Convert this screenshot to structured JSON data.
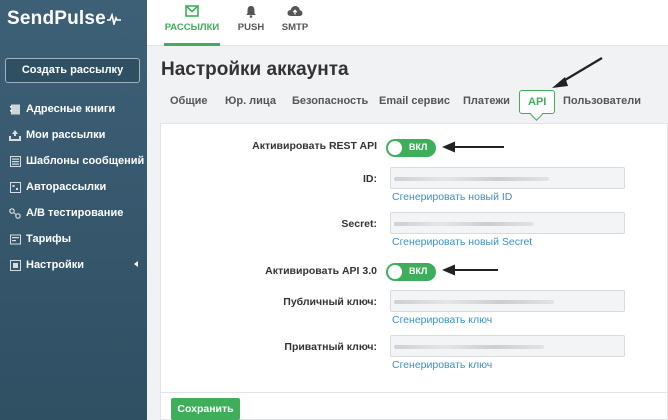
{
  "app": {
    "logo": "SendPulse"
  },
  "sidebar": {
    "create_button": "Создать рассылку",
    "items": [
      {
        "label": "Адресные книги",
        "icon": "address-book-icon"
      },
      {
        "label": "Мои рассылки",
        "icon": "mailings-icon"
      },
      {
        "label": "Шаблоны сообщений",
        "icon": "templates-icon"
      },
      {
        "label": "Авторассылки",
        "icon": "autoresponder-icon"
      },
      {
        "label": "А/В тестирование",
        "icon": "ab-test-icon"
      },
      {
        "label": "Тарифы",
        "icon": "tariffs-icon"
      },
      {
        "label": "Настройки",
        "icon": "settings-icon"
      }
    ]
  },
  "topbar": {
    "tabs": [
      {
        "label": "РАССЫЛКИ",
        "icon": "envelope-icon",
        "active": true
      },
      {
        "label": "PUSH",
        "icon": "bell-icon",
        "active": false
      },
      {
        "label": "SMTP",
        "icon": "cloud-icon",
        "active": false
      }
    ]
  },
  "page": {
    "title": "Настройки аккаунта"
  },
  "tabs": [
    {
      "label": "Общие"
    },
    {
      "label": "Юр. лица"
    },
    {
      "label": "Безопасность"
    },
    {
      "label": "Email сервис"
    },
    {
      "label": "Платежи"
    },
    {
      "label": "API",
      "active": true
    },
    {
      "label": "Пользователи"
    }
  ],
  "api": {
    "rest_label": "Активировать REST API",
    "rest_toggle": "ВКЛ",
    "id_label": "ID:",
    "id_link": "Сгенерировать новый ID",
    "secret_label": "Secret:",
    "secret_link": "Сгенерировать новый Secret",
    "api3_label": "Активировать API 3.0",
    "api3_toggle": "ВКЛ",
    "public_key_label": "Публичный ключ:",
    "public_key_link": "Сгенерировать ключ",
    "private_key_label": "Приватный ключ:",
    "private_key_link": "Сгенерировать ключ"
  },
  "footer": {
    "save_button": "Сохранить"
  },
  "colors": {
    "accent": "#3fae5a",
    "sidebar": "#3e6077",
    "link": "#3d8fc7"
  }
}
